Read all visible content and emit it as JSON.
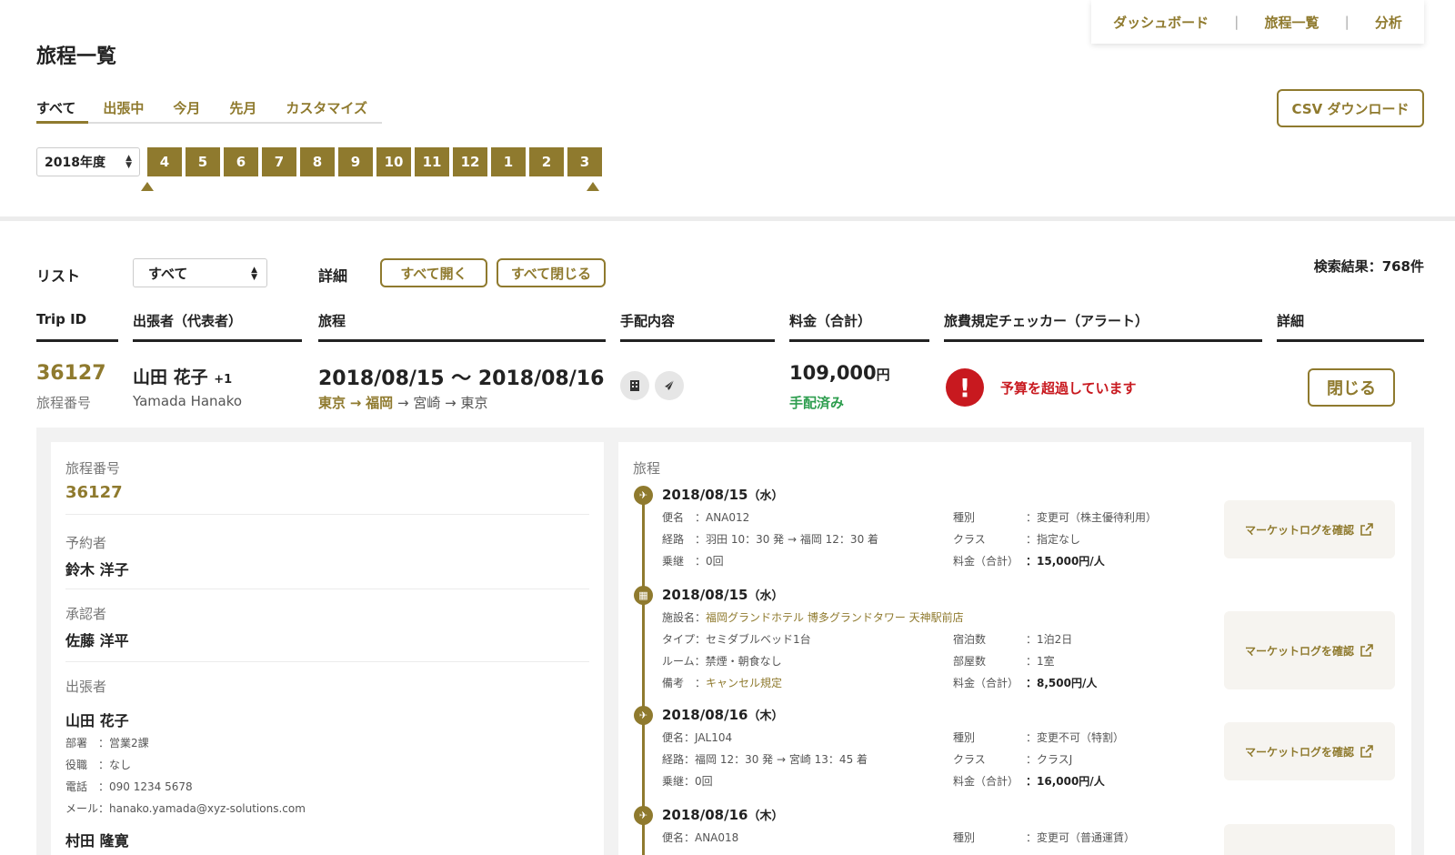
{
  "topnav": {
    "items": [
      "ダッシュボード",
      "旅程一覧",
      "分析"
    ],
    "sep": "|"
  },
  "page": {
    "title": "旅程一覧"
  },
  "tabs": [
    "すべて",
    "出張中",
    "今月",
    "先月",
    "カスタマイズ"
  ],
  "csv_button": "CSV ダウンロード",
  "year_select": {
    "value": "2018年度"
  },
  "months": [
    "4",
    "5",
    "6",
    "7",
    "8",
    "9",
    "10",
    "11",
    "12",
    "1",
    "2",
    "3"
  ],
  "filters": {
    "list_label": "リスト",
    "list_value": "すべて",
    "detail_label": "詳細",
    "expand_all": "すべて開く",
    "collapse_all": "すべて閉じる",
    "result_count": "検索結果：768件"
  },
  "columns": [
    "Trip ID",
    "出張者（代表者）",
    "旅程",
    "手配内容",
    "料金（合計）",
    "旅費規定チェッカー（アラート）",
    "詳細"
  ],
  "trip": {
    "id": "36127",
    "id_sub": "旅程番号",
    "traveler": "山田 花子",
    "traveler_extra": "+1",
    "traveler_en": "Yamada Hanako",
    "dates": "2018/08/15 〜 2018/08/16",
    "route_done_1": "東京",
    "route_arrow_gold": "→",
    "route_done_2": "福岡",
    "route_arrow": "→",
    "route_rest_1": "宮崎",
    "route_rest_2": "東京",
    "arrangement_icons": [
      "hotel-icon",
      "airplane-icon"
    ],
    "price": "109,000",
    "price_unit": "円",
    "price_status": "手配済み",
    "alert_symbol": "!",
    "alert": "予算を超過しています",
    "close_button": "閉じる",
    "colors": {
      "accent": "#8f7a2e",
      "alert": "#c8191f",
      "ok": "#2e9e4f"
    }
  },
  "detail": {
    "itinerary_no_label": "旅程番号",
    "itinerary_no": "36127",
    "booker_label": "予約者",
    "booker": "鈴木 洋子",
    "approver_label": "承認者",
    "approver": "佐藤 洋平",
    "travelers_label": "出張者",
    "traveler_name": "山田 花子",
    "traveler_info": [
      "部署　：営業2課",
      "役職　：なし",
      "電話　：090 1234 5678",
      "メール：hanako.yamada@xyz-solutions.com"
    ],
    "traveler2_name": "村田 隆寛"
  },
  "timeline": {
    "label": "旅程",
    "market_button": "マーケットログを確認",
    "segments": [
      {
        "type": "flight",
        "date": "2018/08/15",
        "dow": "（水）",
        "left": [
          "便名　：ANA012",
          "経路　：羽田 10：30 発 → 福岡 12：30 着",
          "乗継　：0回"
        ],
        "right_keys": [
          "種別",
          "クラス",
          "料金（合計）"
        ],
        "right_vals": [
          "：変更可（株主優待利用）",
          "：指定なし",
          "：15,000円/人"
        ]
      },
      {
        "type": "hotel",
        "date": "2018/08/15",
        "dow": "（水）",
        "facility_label": "施設名：",
        "facility": "福岡グランドホテル 博多グランドタワー 天神駅前店",
        "left": [
          "タイプ：セミダブルベッド1台",
          "ルーム：禁煙・朝食なし"
        ],
        "note_label": "備考　：",
        "note": "キャンセル規定",
        "right_keys": [
          "宿泊数",
          "部屋数",
          "料金（合計）"
        ],
        "right_vals": [
          "：1泊2日",
          "：1室",
          "：8,500円/人"
        ]
      },
      {
        "type": "flight",
        "date": "2018/08/16",
        "dow": "（木）",
        "left": [
          "便名：JAL104",
          "経路：福岡 12：30 発 → 宮崎 13：45 着",
          "乗継：0回"
        ],
        "right_keys": [
          "種別",
          "クラス",
          "料金（合計）"
        ],
        "right_vals": [
          "：変更不可（特割）",
          "：クラスJ",
          "：16,000円/人"
        ]
      },
      {
        "type": "flight",
        "date": "2018/08/16",
        "dow": "（木）",
        "left": [
          "便名：ANA018"
        ],
        "right_keys": [
          "種別"
        ],
        "right_vals": [
          "：変更可（普通運賃）"
        ]
      }
    ]
  }
}
